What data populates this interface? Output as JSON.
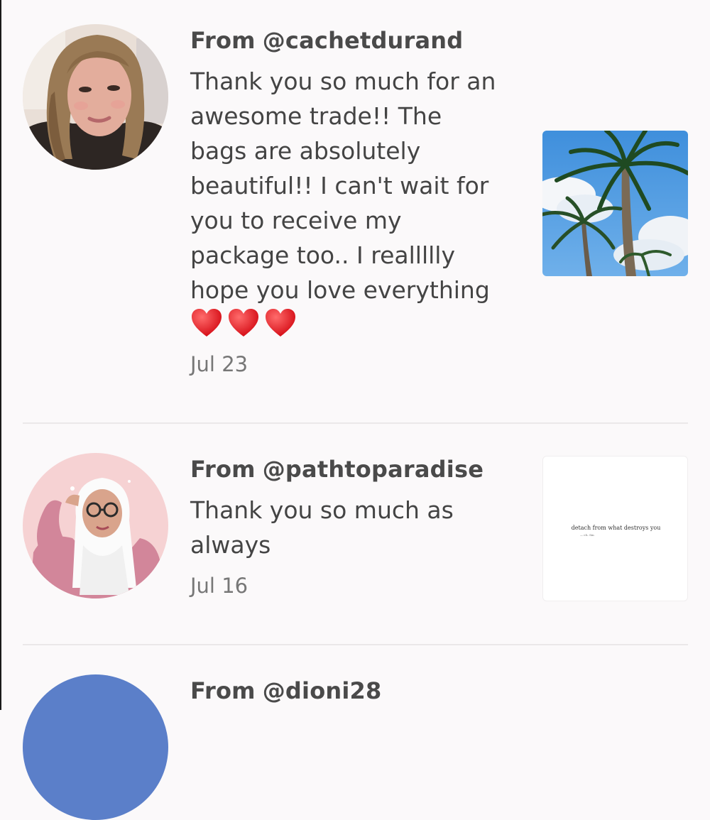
{
  "messages": [
    {
      "sender_prefix": "From",
      "handle": "@cachetdurand",
      "text": "Thank you so much for an\nawesome trade!! The\nbags are absolutely\nbeautiful!! I can't wait for\nyou to receive my\npackage too.. I reallllly\nhope you love everything",
      "emoji": [
        "❤️",
        "❤️",
        "❤️"
      ],
      "date": "Jul 23",
      "attachment": "palm-trees-photo"
    },
    {
      "sender_prefix": "From",
      "handle": "@pathtoparadise",
      "text": "Thank you so much as\nalways",
      "date": "Jul 16",
      "attachment": "quote-image",
      "attachment_quote": "detach from what destroys you",
      "attachment_author": "— r.h. Sin"
    },
    {
      "sender_prefix": "From",
      "handle": "@dioni28"
    }
  ],
  "colors": {
    "background": "#fbf9fa",
    "text": "#444444",
    "date": "#777777",
    "divider": "#ebe8e9",
    "heart": "#e01f1f",
    "avatar3": "#5b7fc9"
  }
}
